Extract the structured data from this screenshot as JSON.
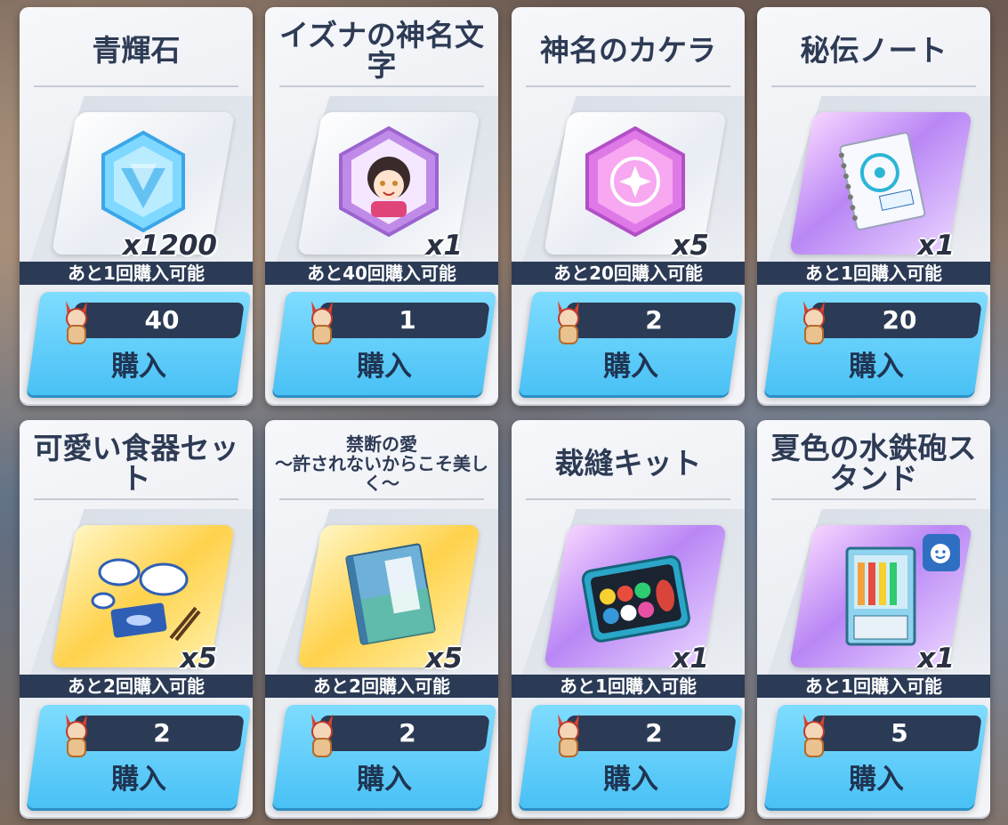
{
  "shop": {
    "items": [
      {
        "name": "青輝石",
        "quantity": "x1200",
        "limit": "あと1回購入可能",
        "price": "40",
        "buy_label": "購入",
        "icon": "blue-gem-icon"
      },
      {
        "name": "イズナの神名文字",
        "quantity": "x1",
        "limit": "あと40回購入可能",
        "price": "1",
        "buy_label": "購入",
        "icon": "character-eleph-icon"
      },
      {
        "name": "神名のカケラ",
        "quantity": "x5",
        "limit": "あと20回購入可能",
        "price": "2",
        "buy_label": "購入",
        "icon": "star-fragment-icon"
      },
      {
        "name": "秘伝ノート",
        "quantity": "x1",
        "limit": "あと1回購入可能",
        "price": "20",
        "buy_label": "購入",
        "icon": "notebook-icon"
      },
      {
        "name": "可愛い食器セット",
        "quantity": "x5",
        "limit": "あと2回購入可能",
        "price": "2",
        "buy_label": "購入",
        "icon": "tableware-icon"
      },
      {
        "name": "禁断の愛\n～許されないからこそ美しく～",
        "quantity": "x5",
        "limit": "あと2回購入可能",
        "price": "2",
        "buy_label": "購入",
        "icon": "book-icon"
      },
      {
        "name": "裁縫キット",
        "quantity": "x1",
        "limit": "あと1回購入可能",
        "price": "2",
        "buy_label": "購入",
        "icon": "sewing-kit-icon"
      },
      {
        "name": "夏色の水鉄砲スタンド",
        "quantity": "x1",
        "limit": "あと1回購入可能",
        "price": "5",
        "buy_label": "購入",
        "icon": "water-gun-stand-icon"
      }
    ]
  },
  "currency_icon": "fox-doll-currency-icon",
  "colors": {
    "title": "#2e3b55",
    "dark_bar": "#2b3a55",
    "buy_button": "#49c1f5"
  }
}
